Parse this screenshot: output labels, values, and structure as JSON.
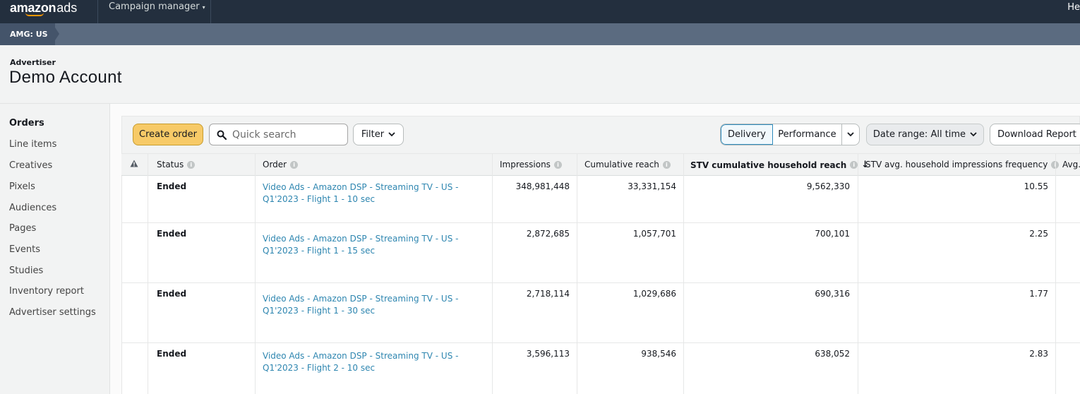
{
  "nav": {
    "logo_amazon": "amazon",
    "logo_ads": "ads",
    "campaign_manager": "Campaign manager",
    "top_right": "He"
  },
  "breadcrumb": {
    "account": "AMG: US"
  },
  "header": {
    "label": "Advertiser",
    "name": "Demo Account"
  },
  "sidebar": {
    "items": [
      {
        "label": "Orders",
        "active": true
      },
      {
        "label": "Line items"
      },
      {
        "label": "Creatives"
      },
      {
        "label": "Pixels"
      },
      {
        "label": "Audiences"
      },
      {
        "label": "Pages"
      },
      {
        "label": "Events"
      },
      {
        "label": "Studies"
      },
      {
        "label": "Inventory report"
      },
      {
        "label": "Advertiser settings"
      }
    ]
  },
  "toolbar": {
    "create_order": "Create order",
    "search_placeholder": "Quick search",
    "filter": "Filter",
    "delivery": "Delivery",
    "performance": "Performance",
    "date_range": "Date range: All time",
    "download": "Download Report"
  },
  "table": {
    "columns": {
      "status": "Status",
      "order": "Order",
      "impressions": "Impressions",
      "cumulative_reach": "Cumulative reach",
      "stv_reach": "STV cumulative household reach",
      "stv_freq": "STV avg. household impressions frequency",
      "avg": "Avg."
    },
    "rows": [
      {
        "status": "Ended",
        "order_line1": "Video Ads - Amazon DSP - Streaming TV - US -",
        "order_line2": "Q1'2023 - Flight 1 - 10 sec",
        "impressions": "348,981,448",
        "cumulative_reach": "33,331,154",
        "stv_reach": "9,562,330",
        "stv_freq": "10.55"
      },
      {
        "status": "Ended",
        "order_line1": "Video Ads - Amazon DSP - Streaming TV - US -",
        "order_line2": "Q1'2023 - Flight 1 - 15 sec",
        "impressions": "2,872,685",
        "cumulative_reach": "1,057,701",
        "stv_reach": "700,101",
        "stv_freq": "2.25"
      },
      {
        "status": "Ended",
        "order_line1": "Video Ads - Amazon DSP - Streaming TV - US -",
        "order_line2": "Q1'2023 - Flight 1 - 30 sec",
        "impressions": "2,718,114",
        "cumulative_reach": "1,029,686",
        "stv_reach": "690,316",
        "stv_freq": "1.77"
      },
      {
        "status": "Ended",
        "order_line1": "Video Ads - Amazon DSP - Streaming TV - US -",
        "order_line2": "Q1'2023 - Flight 2 - 10 sec",
        "impressions": "3,596,113",
        "cumulative_reach": "938,546",
        "stv_reach": "638,052",
        "stv_freq": "2.83"
      }
    ]
  },
  "colors": {
    "topbar": "#232f3e",
    "breadcrumb_band": "#5b6b80",
    "primary_button": "#f7ca67",
    "link": "#2e86b0",
    "accent": "#ff9900"
  }
}
